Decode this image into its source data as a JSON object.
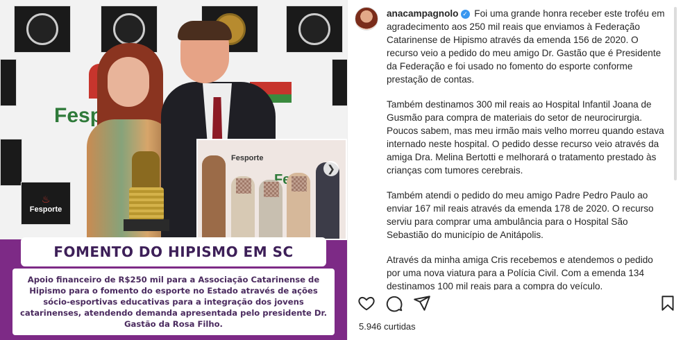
{
  "media": {
    "headline": "FOMENTO DO HIPISMO EM SC",
    "caption": "Apoio financeiro de R$250 mil para a Associação Catarinense de Hipismo para o fomento do esporte no Estado através de ações sócio-esportivas educativas para a integração dos jovens catarinenses, atendendo demanda apresentada pelo presidente Dr. Gastão da Rosa Filho.",
    "backdrop_texts": [
      "Fesporte",
      "Fesporte",
      "Fesporte",
      "Fes"
    ],
    "accent_color": "#7d2a86"
  },
  "post": {
    "username": "anacampagnolo",
    "paragraphs": [
      "Foi uma grande honra receber este troféu em agradecimento aos 250 mil reais que enviamos à Federação Catarinense de Hipismo através da emenda 156 de 2020. O recurso veio a pedido do meu amigo Dr. Gastão que é Presidente da Federação e foi usado no fomento do esporte conforme prestação de contas.",
      "Também destinamos 300 mil reais ao Hospital Infantil Joana de Gusmão para compra de materiais do setor de neurocirurgia. Poucos sabem, mas meu irmão mais velho morreu quando estava internado neste hospital. O pedido desse recurso veio através da amiga Dra. Melina Bertotti e melhorará o tratamento prestado às crianças com tumores cerebrais.",
      "Também atendi o pedido do meu amigo Padre Pedro Paulo ao enviar 167 mil reais através da emenda 178 de 2020. O recurso serviu para comprar uma ambulância para o Hospital São Sebastião do município de Anitápolis.",
      "Através da minha amiga Cris recebemos e atendemos o pedido por uma nova viatura para a Polícia Civil. Com a emenda 134 destinamos 100 mil reais para a compra do veículo."
    ]
  },
  "actions": {
    "like_icon": "heart-icon",
    "comment_icon": "comment-icon",
    "share_icon": "share-icon",
    "save_icon": "bookmark-icon"
  },
  "likes_text": "5.946 curtidas",
  "colors": {
    "verified": "#3897f0",
    "text": "#262626"
  }
}
